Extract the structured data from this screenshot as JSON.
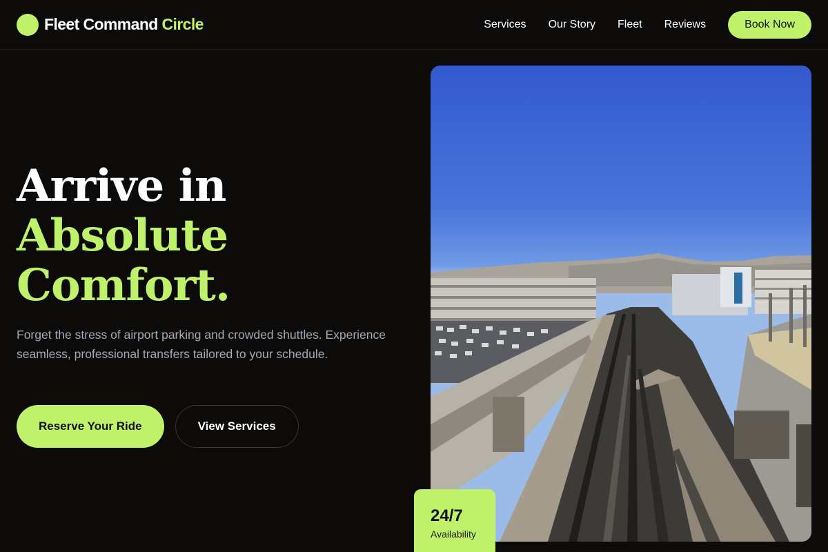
{
  "brand": {
    "name": "Fleet Command",
    "accent": "Circle"
  },
  "nav": {
    "links": [
      "Services",
      "Our Story",
      "Fleet",
      "Reviews"
    ],
    "cta": "Book Now"
  },
  "hero": {
    "title_line1": "Arrive in",
    "title_line2": "Absolute",
    "title_line3": "Comfort.",
    "description": "Forget the stress of airport parking and crowded shuttles. Experience seamless, professional transfers tailored to your schedule.",
    "primary_button": "Reserve Your Ride",
    "secondary_button": "View Services"
  },
  "badge": {
    "value": "24/7",
    "label": "Availability"
  },
  "colors": {
    "accent": "#bff26a",
    "background": "#0c0b0a",
    "muted_text": "#a4a9b6"
  },
  "image": {
    "subject": "elevated airport train tracks with parking garages and hills"
  }
}
